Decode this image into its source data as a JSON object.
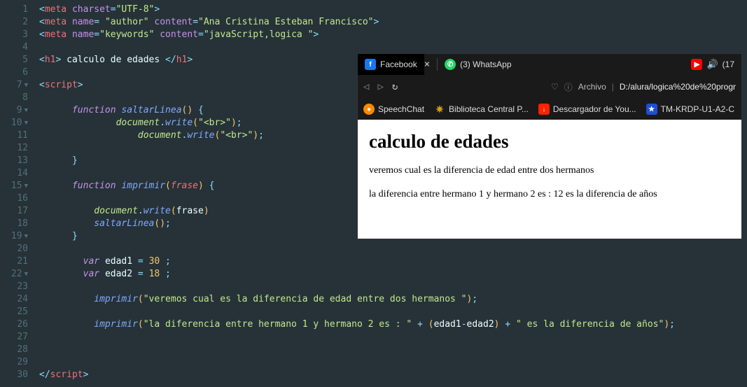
{
  "editor": {
    "lines": [
      "1",
      "2",
      "3",
      "4",
      "5",
      "6",
      "7",
      "8",
      "9",
      "10",
      "11",
      "12",
      "13",
      "14",
      "15",
      "16",
      "17",
      "18",
      "19",
      "20",
      "21",
      "22",
      "23",
      "24",
      "25",
      "26",
      "27",
      "28",
      "29",
      "30"
    ],
    "fold_lines": [
      7,
      9,
      10,
      15,
      19,
      22
    ],
    "code": {
      "meta_charset": "UTF-8",
      "author_name": "author",
      "author_content": "Ana Cristina Esteban Francisco",
      "keywords_name": "keywords",
      "keywords_content": "javaScript,logica ",
      "h1_text": " calculo de edades ",
      "fn_saltar": "saltarLinea",
      "fn_imprimir": "imprimir",
      "param": "frase",
      "doc_write": "write",
      "br": "\"<br>\"",
      "edad1_name": "edad1",
      "edad1_val": "30",
      "edad2_name": "edad2",
      "edad2_val": "18",
      "str_veremos": "\"veremos cual es la diferencia de edad entre dos hermanos \"",
      "str_dif1": "\"la diferencia entre hermano 1 y hermano 2 es : \"",
      "str_dif2": "\" es la diferencia de años\""
    }
  },
  "browser": {
    "tabs": {
      "facebook": "Facebook",
      "whatsapp": "(3) WhatsApp",
      "vol_label": "(17"
    },
    "addr": {
      "archivo": "Archivo",
      "path": "D:/alura/logica%20de%20progr"
    },
    "bookmarks": {
      "speechchat": "SpeechChat",
      "biblioteca": "Biblioteca Central P...",
      "descargador": "Descargador de You...",
      "tmkrdp": "TM-KRDP-U1-A2-C"
    },
    "page": {
      "h1": "calculo de edades",
      "p1": "veremos cual es la diferencia de edad entre dos hermanos",
      "p2": "la diferencia entre hermano 1 y hermano 2 es : 12 es la diferencia de años"
    }
  }
}
